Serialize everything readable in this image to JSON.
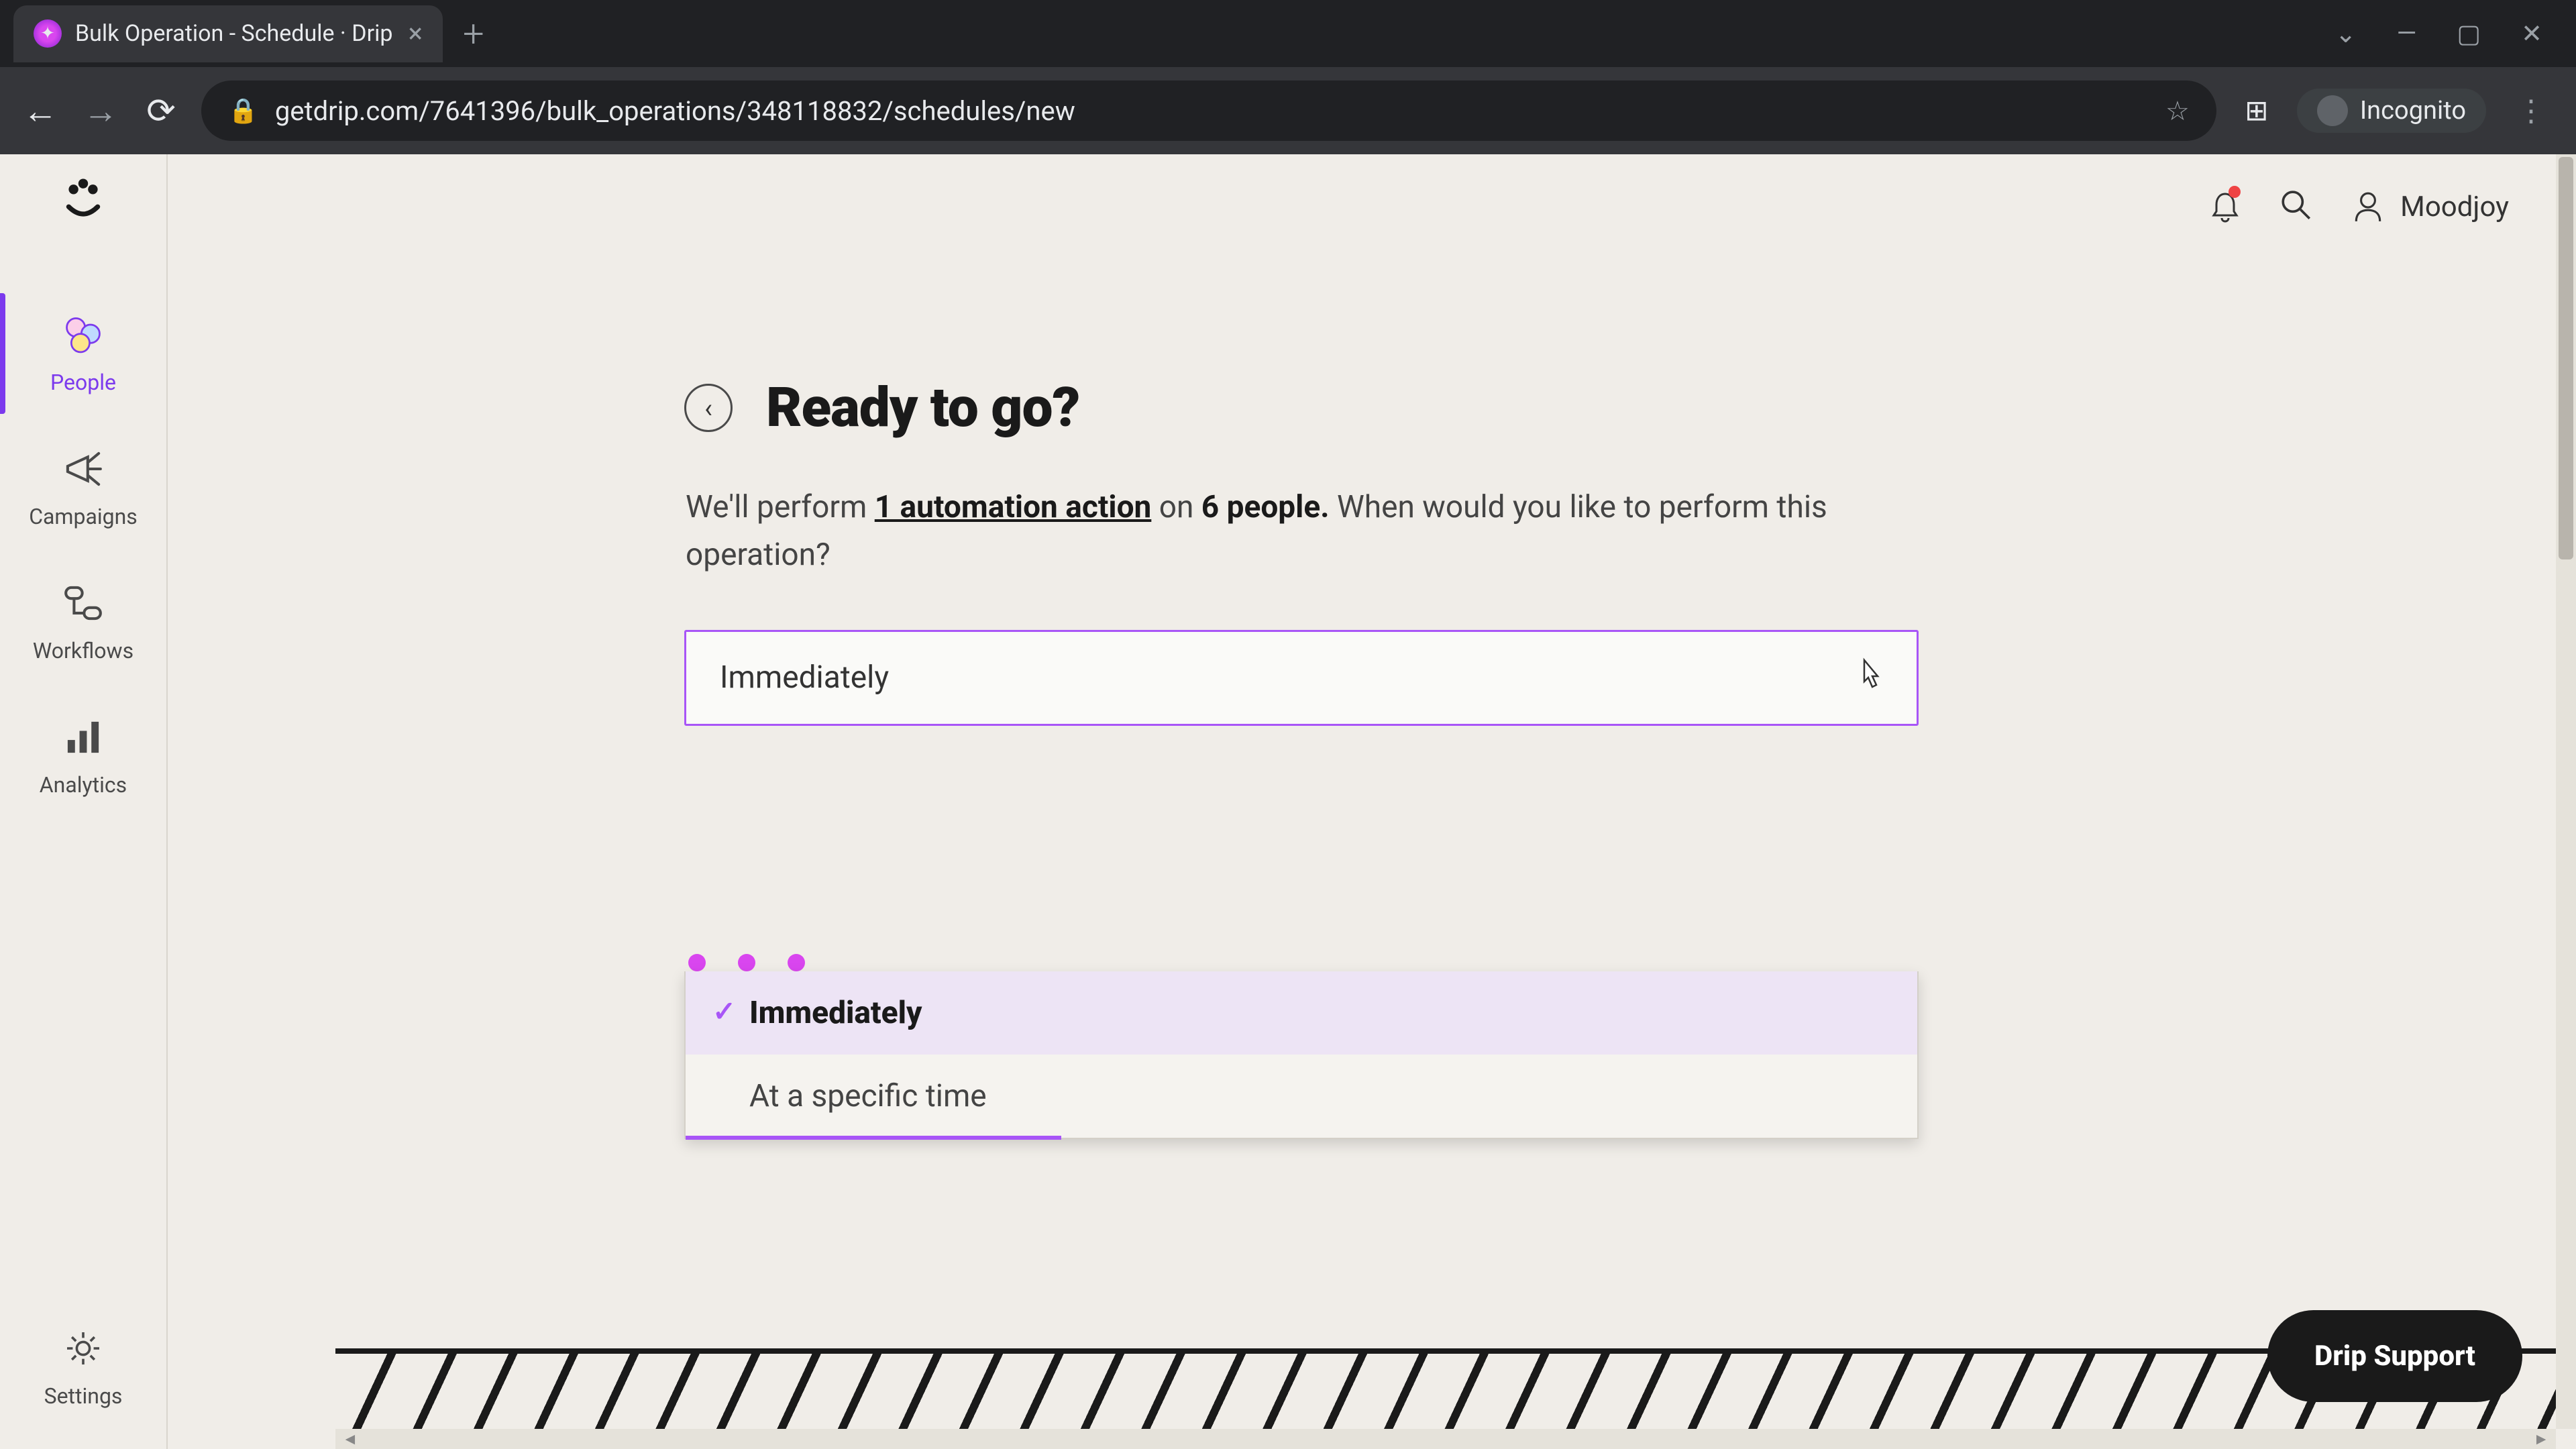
{
  "browser": {
    "tab_title": "Bulk Operation - Schedule · Drip",
    "url": "getdrip.com/7641396/bulk_operations/348118832/schedules/new",
    "incognito_label": "Incognito"
  },
  "sidebar": {
    "items": [
      {
        "label": "People"
      },
      {
        "label": "Campaigns"
      },
      {
        "label": "Workflows"
      },
      {
        "label": "Analytics"
      },
      {
        "label": "Settings"
      }
    ]
  },
  "topbar": {
    "user_name": "Moodjoy"
  },
  "page": {
    "title": "Ready to go?",
    "desc_prefix": "We'll perform ",
    "desc_link": "1 automation action",
    "desc_mid": " on ",
    "desc_bold": "6 people.",
    "desc_suffix": " When would you like to perform this operation?"
  },
  "dropdown": {
    "selected": "Immediately",
    "options": [
      {
        "label": "Immediately",
        "selected": true
      },
      {
        "label": "At a specific time",
        "selected": false
      }
    ]
  },
  "support": {
    "label": "Drip Support"
  }
}
